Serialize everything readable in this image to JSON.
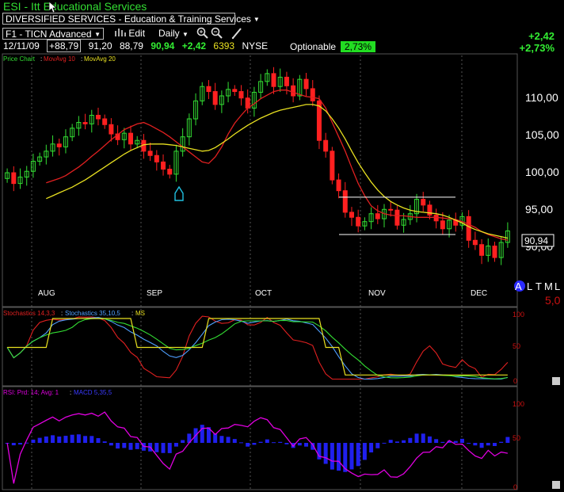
{
  "header": {
    "title": "ESI - Itt Educational Services",
    "sector": "DIVERSIFIED SERVICES - Education & Training Services",
    "layout": "F1 - TICN Advanced",
    "edit_label": "Edit",
    "period": "Daily",
    "date": "12/11/09",
    "open": "+88,79",
    "high": "91,20",
    "low": "88,79",
    "close": "90,94",
    "change": "+2,42",
    "volume": "6393",
    "exchange": "NYSE",
    "optionable_label": "Optionable",
    "optionable_pct": "2,73%",
    "change_abs": "+2,42",
    "change_pct": "+2,73%",
    "mode_letters": [
      "A",
      "L",
      "T",
      "M",
      "L"
    ],
    "corner_value": "5,0"
  },
  "chart_data": [
    {
      "type": "candlestick",
      "title": "Price Chart",
      "legend": [
        {
          "name": "Price Chart",
          "color": "#33dd33"
        },
        {
          "name": "MovAvg 10",
          "color": "#e02020"
        },
        {
          "name": "MovAvg 20",
          "color": "#e8e020"
        }
      ],
      "x_labels": [
        "AUG",
        "SEP",
        "OCT",
        "NOV",
        "DEC"
      ],
      "y_ticks": [
        "110,00",
        "105,00",
        "100,00",
        "95,00",
        "90,00"
      ],
      "ylim": [
        85,
        114
      ],
      "last_price_label": "90,94",
      "closes": [
        99,
        97.5,
        98.4,
        99.2,
        100.6,
        101.2,
        102,
        103,
        102.6,
        104,
        105.2,
        106,
        105.8,
        107,
        106.5,
        105.7,
        104.4,
        103.6,
        104.5,
        103,
        103.5,
        102,
        101.4,
        100.5,
        99.5,
        98.8,
        102,
        104,
        106.5,
        109,
        111,
        110.3,
        108.5,
        109.7,
        110.6,
        110.3,
        109.4,
        108,
        110.2,
        111.7,
        112.8,
        111,
        112.3,
        111.1,
        109.7,
        112,
        110.7,
        109,
        103.5,
        102,
        98,
        96.5,
        93.5,
        92.8,
        91.6,
        92.2,
        93.3,
        92.6,
        93.9,
        93.8,
        91.7,
        92.5,
        93.3,
        95.3,
        94.5,
        93.1,
        92.3,
        91.2,
        92.4,
        91.7,
        92.9,
        89.6,
        89,
        87.5,
        88.8,
        87.2,
        89.3,
        90.9
      ],
      "series": [
        {
          "name": "MovAvg 10",
          "values": [
            97.6,
            97.9,
            98.2,
            98.6,
            99.2,
            99.8,
            100.5,
            101.3,
            102,
            102.8,
            103.6,
            104.3,
            105,
            105.4,
            105.8,
            106,
            105.6,
            105.1,
            104.6,
            104,
            103.3,
            102.6,
            101.9,
            101.2,
            100.5,
            100.3,
            101.2,
            102.6,
            104.4,
            105.9,
            107,
            108,
            108.6,
            109.3,
            109.8,
            110.3,
            110.5,
            110.5,
            110.2,
            109.9,
            109.6,
            109.5,
            109.3,
            108,
            106,
            104,
            102,
            99.7,
            97.5,
            95.8,
            94.4,
            93.7,
            93.3,
            93.1,
            93,
            93,
            92.9,
            92.8,
            92.8,
            92.8,
            92.8,
            92.7,
            92.6,
            92.5,
            92.2,
            91.8,
            91.4,
            90.8,
            90.4,
            90.1,
            89.8,
            89.6
          ]
        },
        {
          "name": "MovAvg 20",
          "values": [
            95.4,
            95.8,
            96.2,
            96.6,
            97,
            97.5,
            98,
            98.6,
            99.2,
            99.8,
            100.4,
            101,
            101.6,
            102.1,
            102.5,
            102.9,
            103,
            103,
            103,
            102.9,
            102.8,
            102.6,
            102.4,
            102.2,
            102,
            102.1,
            102.5,
            103.1,
            103.7,
            104.4,
            105,
            105.6,
            106.1,
            106.6,
            107,
            107.4,
            107.7,
            107.9,
            108.1,
            108.3,
            108.5,
            108.5,
            108.3,
            107.6,
            106.5,
            105.2,
            103.7,
            102,
            100.4,
            99,
            97.7,
            96.6,
            95.7,
            95,
            94.5,
            94.1,
            93.8,
            93.6,
            93.5,
            93.4,
            93.3,
            93.1,
            92.8,
            92.4,
            92,
            91.5,
            91.1,
            90.8,
            90.5,
            90.3,
            90.1,
            89.9
          ]
        }
      ],
      "annotations": [
        {
          "type": "hline",
          "value": 95.6,
          "color": "#ffffff"
        },
        {
          "type": "hline",
          "value": 90.4,
          "color": "#ffffff"
        }
      ]
    },
    {
      "type": "line",
      "title": "Stochastics 14,3,3 : Stochastics 35,10,5 : MS",
      "legend": [
        {
          "name": "Stochastics 14,3,3",
          "color": "#e02020"
        },
        {
          "name": "Stochastics 35,10,5",
          "color": "#4fa0ff"
        },
        {
          "name": "MS",
          "color": "#e8e020"
        }
      ],
      "y_ticks": [
        "100",
        "50",
        "0"
      ],
      "ylim": [
        0,
        100
      ]
    },
    {
      "type": "bar",
      "title": "RSI: Prd: 14; Avg: 1 : MACD 5,35,5",
      "legend": [
        {
          "name": "RSI: Prd: 14; Avg: 1",
          "color": "#e000e0"
        },
        {
          "name": "MACD 5,35,5",
          "color": "#2020ff"
        }
      ],
      "y_ticks": [
        "100",
        "50",
        "0"
      ],
      "ylim": [
        0,
        100
      ]
    }
  ]
}
